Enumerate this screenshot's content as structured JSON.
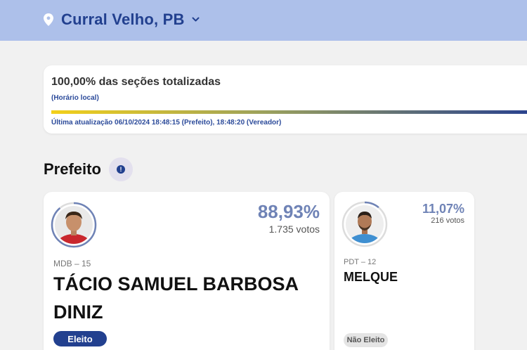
{
  "header": {
    "location": "Curral Velho, PB",
    "icons": {
      "pin": "location-pin-icon",
      "chevron": "chevron-down-icon"
    }
  },
  "status": {
    "title": "100,00% das seções totalizadas",
    "time_note": "(Horário local)",
    "progress": 1.0,
    "last_update": "Última atualização 06/10/2024 18:48:15 (Prefeito), 18:48:20 (Vereador)"
  },
  "section": {
    "title": "Prefeito",
    "info_icon": "info-icon"
  },
  "candidates": [
    {
      "percent": "88,93%",
      "votes": "1.735 votos",
      "party": "MDB – 15",
      "name": "TÁCIO SAMUEL BARBOSA DINIZ",
      "result": "Eleito",
      "ring_fraction": 0.8893
    },
    {
      "percent": "11,07%",
      "votes": "216 votos",
      "party": "PDT – 12",
      "name": "MELQUE",
      "result": "Não Eleito",
      "ring_fraction": 0.1107
    }
  ],
  "colors": {
    "header_bg": "#adc0ea",
    "brand_blue": "#22408f",
    "percent_text": "#6f83b6",
    "progress_start": "#f3d01a",
    "progress_end": "#27408f"
  }
}
